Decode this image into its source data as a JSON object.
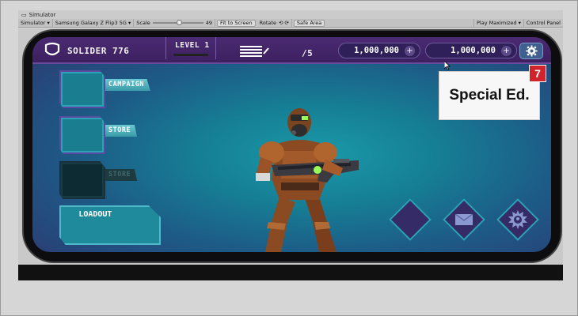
{
  "window": {
    "title": "Simulator"
  },
  "toolbar": {
    "mode": "Simulator",
    "device": "Samsung Galaxy Z Flip3 5G",
    "scale_label": "Scale",
    "scale_value": "49",
    "fit_to_screen": "Fit to Screen",
    "rotate": "Rotate",
    "safe_area": "Safe Area",
    "play_mode": "Play Maximized",
    "control_panel": "Control Panel"
  },
  "hud": {
    "player_name": "SOLIDER 776",
    "level": "LEVEL 1",
    "progress": "/5",
    "currency_1": "1,000,000",
    "currency_2": "1,000,000",
    "plus": "+"
  },
  "menu": {
    "campaign": "CAMPAIGN",
    "store": "STORE",
    "store_disabled": "STORE",
    "loadout": "LOADOUT"
  },
  "popup": {
    "label": "Special Ed.",
    "badge": "7"
  },
  "icons": {
    "settings": "gear-icon",
    "mail": "mail-icon",
    "badge": "spiked-eye-icon"
  },
  "colors": {
    "hud_bg": "#4b2a72",
    "accent": "#2aa3b6",
    "badge": "#d0232b"
  }
}
